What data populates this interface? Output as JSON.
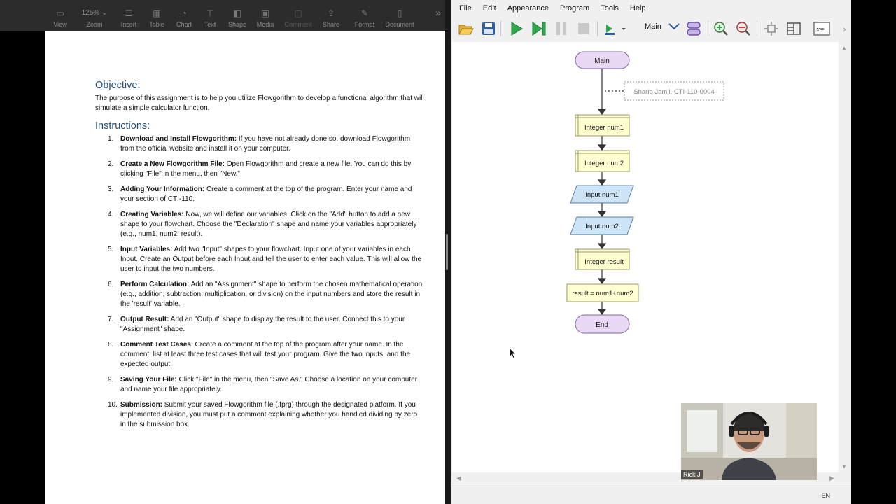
{
  "pages_toolbar": {
    "items": [
      {
        "label": "View",
        "icon": "sidebar-icon"
      },
      {
        "label": "Zoom",
        "value": "125%",
        "icon": "chevron-down-icon"
      },
      {
        "label": "Insert",
        "icon": "list-icon"
      },
      {
        "label": "Table",
        "icon": "table-icon"
      },
      {
        "label": "Chart",
        "icon": "chart-icon"
      },
      {
        "label": "Text",
        "icon": "text-icon"
      },
      {
        "label": "Shape",
        "icon": "shape-icon"
      },
      {
        "label": "Media",
        "icon": "image-icon"
      },
      {
        "label": "Comment",
        "icon": "comment-icon"
      },
      {
        "label": "Share",
        "icon": "share-icon"
      },
      {
        "label": "Format",
        "icon": "format-icon"
      },
      {
        "label": "Document",
        "icon": "document-icon"
      }
    ]
  },
  "document": {
    "objective_heading": "Objective:",
    "objective_text": "The purpose of this assignment is to help you utilize Flowgorithm to develop a functional algorithm that will simulate a simple calculator function.",
    "instructions_heading": "Instructions:",
    "steps": [
      {
        "num": "1.",
        "title": "Download and Install Flowgorithm:",
        "text": " If you have not already done so, download Flowgorithm from the official website and install it on your computer."
      },
      {
        "num": "2.",
        "title": "Create a New Flowgorithm File:",
        "text": " Open Flowgorithm and create a new file. You can do this by clicking \"File\" in the menu, then \"New.\""
      },
      {
        "num": "3.",
        "title": "Adding Your Information:",
        "text": " Create a comment at the top of the program.  Enter your name and your section of CTI-110."
      },
      {
        "num": "4.",
        "title": "Creating Variables:",
        "text": " Now, we will define our variables. Click on the \"Add\" button to add a new shape to your flowchart. Choose the \"Declaration\" shape and name your variables appropriately (e.g., num1, num2, result)."
      },
      {
        "num": "5.",
        "title": "Input Variables:",
        "text": " Add two \"Input\" shapes to your flowchart.  Input one of your variables in each Input.  Create an Output before each Input and tell the user to enter each value. This will allow the user to input the two numbers."
      },
      {
        "num": "6.",
        "title": "Perform Calculation:",
        "text": " Add an \"Assignment\" shape to perform the chosen mathematical operation (e.g., addition, subtraction, multiplication, or division) on the input numbers and store the result in the 'result' variable."
      },
      {
        "num": "7.",
        "title": "Output Result:",
        "text": " Add an \"Output\" shape to display the result to the user. Connect this to your \"Assignment\" shape."
      },
      {
        "num": "8.",
        "title": "Comment Test Cases",
        "text": ":  Create a comment at the top of the program after your name.  In the comment, list at least three test cases that will test your program.  Give the two inputs, and the expected output."
      },
      {
        "num": "9.",
        "title": "Saving Your File:",
        "text": " Click \"File\" in the menu, then \"Save As.\" Choose a location on your computer and name your file appropriately."
      },
      {
        "num": "10.",
        "title": "Submission:",
        "text": " Submit your saved Flowgorithm file (.fprg) through the designated platform.  If you implemented division, you must put a comment explaining whether you handled dividing by zero in the submission box."
      }
    ]
  },
  "flowgorithm": {
    "menu": [
      "File",
      "Edit",
      "Appearance",
      "Program",
      "Tools",
      "Help"
    ],
    "function_select": "Main",
    "flowchart": {
      "start": "Main",
      "comment": "Shariq Jamil, CTI-110-0004",
      "shapes": [
        {
          "type": "declare",
          "label": "Integer num1"
        },
        {
          "type": "declare",
          "label": "Integer num2"
        },
        {
          "type": "input",
          "label": "Input num1"
        },
        {
          "type": "input",
          "label": "Input num2"
        },
        {
          "type": "declare",
          "label": "Integer result"
        },
        {
          "type": "assign",
          "label": "result = num1+num2"
        }
      ],
      "end": "End"
    },
    "status_lang": "EN"
  },
  "webcam": {
    "name": "Rick J"
  }
}
